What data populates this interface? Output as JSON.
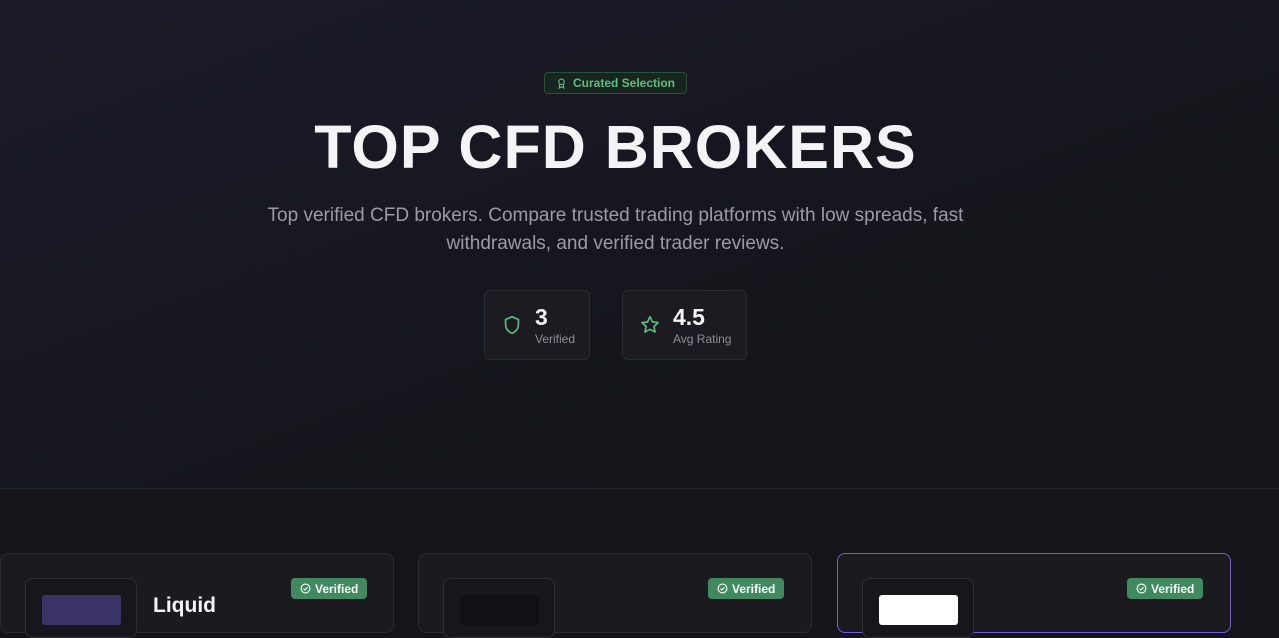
{
  "hero": {
    "badge": "Curated Selection",
    "title": "TOP CFD BROKERS",
    "subtitle": "Top verified CFD brokers. Compare trusted trading platforms with low spreads, fast withdrawals, and verified trader reviews.",
    "stats": [
      {
        "value": "3",
        "label": "Verified",
        "icon": "shield-icon"
      },
      {
        "value": "4.5",
        "label": "Avg Rating",
        "icon": "star-icon"
      }
    ]
  },
  "brokers": [
    {
      "name": "Liquid",
      "badge": "Verified",
      "logo_color": "#3a3466",
      "featured": false
    },
    {
      "name": "",
      "badge": "Verified",
      "logo_color": "#101016",
      "featured": false
    },
    {
      "name": "",
      "badge": "Verified",
      "logo_color": "#ffffff",
      "featured": true
    }
  ],
  "colors": {
    "accent_green": "#5cbf82",
    "verified_green": "#3f8a5e",
    "featured_border": "#7c5bd9",
    "background": "#141419"
  }
}
